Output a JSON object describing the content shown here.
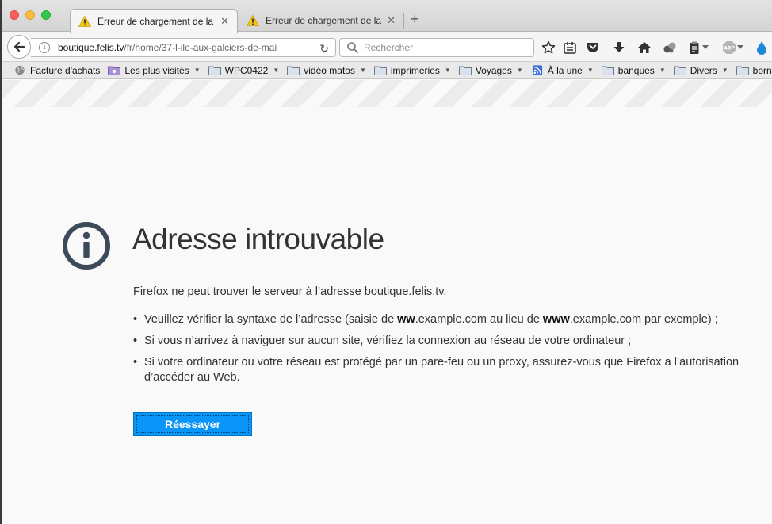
{
  "tabs": [
    {
      "title": "Erreur de chargement de la …",
      "active": true,
      "icon": "warning-icon"
    },
    {
      "title": "Erreur de chargement de la …",
      "active": false,
      "icon": "warning-icon"
    }
  ],
  "new_tab_label": "+",
  "navbar": {
    "url_domain": "boutique.felis.tv",
    "url_path": "/fr/home/37-l-ile-aux-galciers-de-mai",
    "search_placeholder": "Rechercher"
  },
  "bookmarks": [
    {
      "label": "Facture d'achats",
      "icon": "globe-icon",
      "dropdown": false
    },
    {
      "label": "Les plus visités",
      "icon": "smart-folder-icon",
      "dropdown": true
    },
    {
      "label": "WPC0422",
      "icon": "folder-icon",
      "dropdown": true
    },
    {
      "label": "vidéo matos",
      "icon": "folder-icon",
      "dropdown": true
    },
    {
      "label": "imprimeries",
      "icon": "folder-icon",
      "dropdown": true
    },
    {
      "label": "Voyages",
      "icon": "folder-icon",
      "dropdown": true
    },
    {
      "label": "À la une",
      "icon": "rss-icon",
      "dropdown": true
    },
    {
      "label": "banques",
      "icon": "folder-icon",
      "dropdown": true
    },
    {
      "label": "Divers",
      "icon": "folder-icon",
      "dropdown": true
    },
    {
      "label": "borneo",
      "icon": "folder-icon",
      "dropdown": false
    }
  ],
  "error": {
    "title": "Adresse introuvable",
    "lead": "Firefox ne peut trouver le serveur à l’adresse boutique.felis.tv.",
    "item1_a": "Veuillez vérifier la syntaxe de l’adresse (saisie de ",
    "item1_b": "ww",
    "item1_c": ".example.com au lieu de ",
    "item1_d": "www",
    "item1_e": ".example.com par exemple) ;",
    "item2": "Si vous n’arrivez à naviguer sur aucun site, vérifiez la connexion au réseau de votre ordinateur ;",
    "item3": "Si votre ordinateur ou votre réseau est protégé par un pare-feu ou un proxy, assurez-vous que Firefox a l’autorisation d’accéder au Web.",
    "retry_label": "Réessayer"
  },
  "colors": {
    "accent": "#0996f8",
    "warning": "#f5c518"
  }
}
